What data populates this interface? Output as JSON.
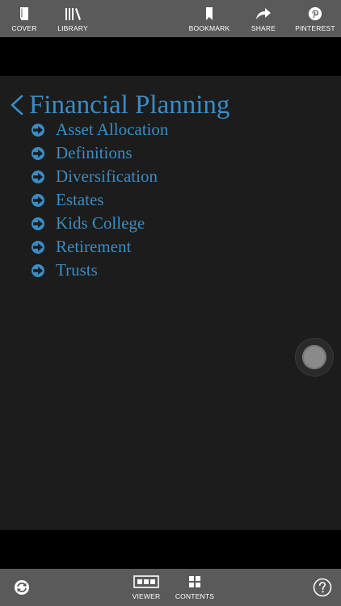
{
  "toolbar": {
    "cover": {
      "label": "COVER",
      "icon": "book-icon"
    },
    "library": {
      "label": "LIBRARY",
      "icon": "library-icon"
    },
    "bookmark": {
      "label": "BOOKMARK",
      "icon": "bookmark-icon"
    },
    "share": {
      "label": "SHARE",
      "icon": "share-icon"
    },
    "pinterest": {
      "label": "PINTEREST",
      "icon": "pinterest-icon"
    }
  },
  "page": {
    "title": "Financial Planning",
    "back_icon": "chevron-left-icon",
    "item_icon": "arrow-circle-right-icon",
    "items": [
      {
        "label": "Asset Allocation"
      },
      {
        "label": "Definitions"
      },
      {
        "label": "Diversification"
      },
      {
        "label": "Estates"
      },
      {
        "label": "Kids College"
      },
      {
        "label": "Retirement"
      },
      {
        "label": "Trusts"
      }
    ]
  },
  "bottom_toolbar": {
    "rotate": {
      "icon": "rotate-icon"
    },
    "viewer": {
      "label": "VIEWER",
      "icon": "viewer-icon"
    },
    "contents": {
      "label": "CONTENTS",
      "icon": "grid-icon"
    },
    "help": {
      "icon": "help-icon"
    }
  },
  "colors": {
    "toolbar_bg": "#5a5a5a",
    "content_bg": "#1c1c1c",
    "accent": "#3a8cc4"
  }
}
